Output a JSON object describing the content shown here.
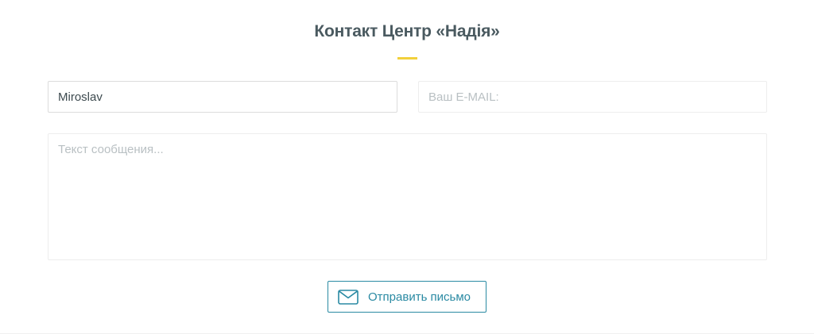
{
  "form": {
    "title": "Контакт Центр «Надія»",
    "name_value": "Miroslav",
    "email_placeholder": "Ваш E-MAIL:",
    "message_placeholder": "Текст сообщения...",
    "send_label": "Отправить письмо",
    "send_icon": "envelope-icon"
  },
  "colors": {
    "title": "#4a5a60",
    "accent": "#f2d03b",
    "button": "#2a8aa3"
  }
}
